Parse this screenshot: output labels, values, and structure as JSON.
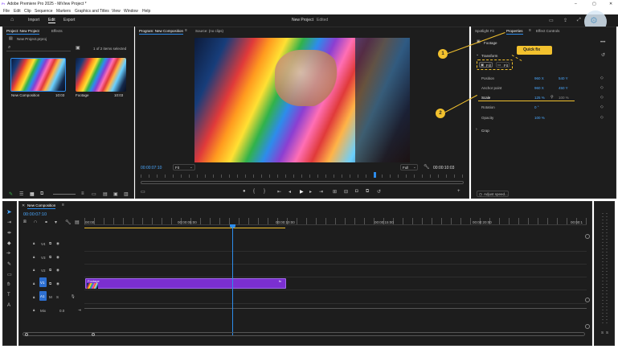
{
  "app": {
    "title": "Adobe Premiere Pro 2025 - MiView Project *",
    "project_title": "New Project",
    "project_status": "Edited"
  },
  "window_controls": {
    "minimize": "–",
    "maximize": "▢",
    "close": "✕"
  },
  "menu": [
    "File",
    "Edit",
    "Clip",
    "Sequence",
    "Markers",
    "Graphics and Titles",
    "View",
    "Window",
    "Help"
  ],
  "workspace_tabs": [
    "Import",
    "Edit",
    "Export"
  ],
  "workspace_active": "Edit",
  "project_panel": {
    "tabs": [
      "Project: New Project",
      "Effects"
    ],
    "file": "New Project.prproj",
    "items_status": "1 of 2 items selected",
    "items": [
      {
        "name": "New Composition",
        "duration": "10:03"
      },
      {
        "name": "Footage",
        "duration": "10:03"
      }
    ]
  },
  "program_monitor": {
    "tabs": [
      "Program: New Composition",
      "Source: (no clips)"
    ],
    "timecode": "00:00:07:10",
    "fit": "Fit",
    "quality": "Full",
    "duration": "00:00:10:03"
  },
  "properties_panel": {
    "tabs": [
      "Spotlight Fit",
      "Properties",
      "Effect Controls"
    ],
    "clip_name": "Footage",
    "more": "•••",
    "section_transform": "Transform",
    "quick_fix_label": "Quick fix",
    "fill_label": "Fill",
    "fit_label": "Fit",
    "properties": [
      {
        "name": "Position",
        "v1": "960 X",
        "v2": "540 Y"
      },
      {
        "name": "Anchor point",
        "v1": "960 X",
        "v2": "450 Y"
      },
      {
        "name": "Scale",
        "v1": "125 %",
        "v2": "100 %"
      },
      {
        "name": "Rotation",
        "v1": "0 °",
        "v2": ""
      },
      {
        "name": "Opacity",
        "v1": "100 %",
        "v2": ""
      }
    ],
    "section_crop": "Crop",
    "adjust_speed": "Adjust speed..."
  },
  "annotations": {
    "one": "1",
    "two": "2"
  },
  "timeline": {
    "sequence_name": "New Composition",
    "timecode": "00:00:07:10",
    "ruler": [
      "00:00",
      "00:00:05:00",
      "00:00:10:00",
      "00:00:15:00",
      "00:00:20:00",
      "00:00:1"
    ],
    "tracks": [
      {
        "name": "V4"
      },
      {
        "name": "V3"
      },
      {
        "name": "V2"
      },
      {
        "name": "V1"
      },
      {
        "name": "A1"
      }
    ],
    "mix_label": "Mix",
    "mix_value": "0.0",
    "clip_name": "Footage",
    "clip_fx": "fx"
  },
  "meter_labels": [
    "S",
    "S"
  ],
  "colors": {
    "accent": "#2d8ceb",
    "clip": "#7b2fd0",
    "annotation": "#f2c12e",
    "timecode": "#4aa8ff"
  }
}
